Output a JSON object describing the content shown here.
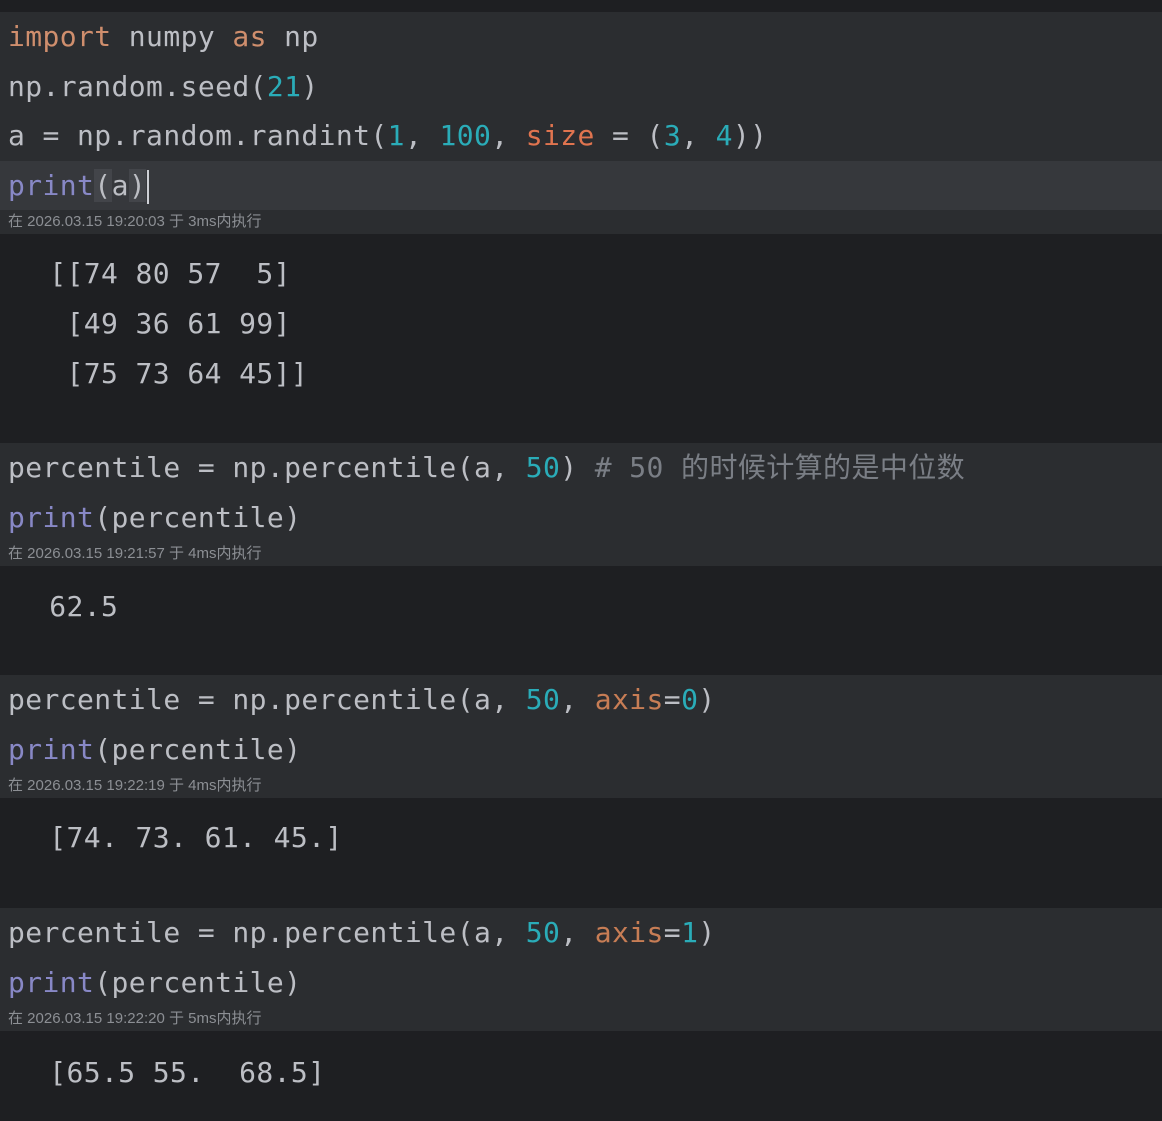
{
  "cells": [
    {
      "code_lines": [
        [
          {
            "t": "import",
            "c": "kw"
          },
          {
            "t": " numpy ",
            "c": "plain"
          },
          {
            "t": "as",
            "c": "kw"
          },
          {
            "t": " np",
            "c": "plain"
          }
        ],
        [
          {
            "t": "np.random.seed(",
            "c": "plain"
          },
          {
            "t": "21",
            "c": "num"
          },
          {
            "t": ")",
            "c": "plain"
          }
        ],
        [
          {
            "t": "a = np.random.randint(",
            "c": "plain"
          },
          {
            "t": "1",
            "c": "num"
          },
          {
            "t": ", ",
            "c": "plain"
          },
          {
            "t": "100",
            "c": "num"
          },
          {
            "t": ", ",
            "c": "plain"
          },
          {
            "t": "size",
            "c": "param"
          },
          {
            "t": " = (",
            "c": "plain"
          },
          {
            "t": "3",
            "c": "num"
          },
          {
            "t": ", ",
            "c": "plain"
          },
          {
            "t": "4",
            "c": "num"
          },
          {
            "t": "))",
            "c": "plain"
          }
        ],
        [
          {
            "t": "print",
            "c": "builtin"
          },
          {
            "t": "(",
            "c": "plain bracket-hl"
          },
          {
            "t": "a",
            "c": "plain"
          },
          {
            "t": ")",
            "c": "plain bracket-hl"
          }
        ]
      ],
      "current_line": 3,
      "exec_info": "在 2026.03.15 19:20:03 于 3ms内执行",
      "output": [
        " [[74 80 57  5]",
        "  [49 36 61 99]",
        "  [75 73 64 45]]"
      ]
    },
    {
      "code_lines": [
        [
          {
            "t": "percentile = np.percentile(a, ",
            "c": "plain"
          },
          {
            "t": "50",
            "c": "num"
          },
          {
            "t": ") ",
            "c": "plain"
          },
          {
            "t": "# 50 的时候计算的是中位数",
            "c": "comment"
          }
        ],
        [
          {
            "t": "print",
            "c": "builtin"
          },
          {
            "t": "(percentile)",
            "c": "plain"
          }
        ]
      ],
      "current_line": -1,
      "exec_info": "在 2026.03.15 19:21:57 于 4ms内执行",
      "output": [
        " 62.5"
      ]
    },
    {
      "code_lines": [
        [
          {
            "t": "percentile = np.percentile(a, ",
            "c": "plain"
          },
          {
            "t": "50",
            "c": "num"
          },
          {
            "t": ", ",
            "c": "plain"
          },
          {
            "t": "axis",
            "c": "param2"
          },
          {
            "t": "=",
            "c": "plain"
          },
          {
            "t": "0",
            "c": "num"
          },
          {
            "t": ")",
            "c": "plain"
          }
        ],
        [
          {
            "t": "print",
            "c": "builtin"
          },
          {
            "t": "(percentile)",
            "c": "plain"
          }
        ]
      ],
      "current_line": -1,
      "exec_info": "在 2026.03.15 19:22:19 于 4ms内执行",
      "output": [
        " [74. 73. 61. 45.]"
      ]
    },
    {
      "code_lines": [
        [
          {
            "t": "percentile = np.percentile(a, ",
            "c": "plain"
          },
          {
            "t": "50",
            "c": "num"
          },
          {
            "t": ", ",
            "c": "plain"
          },
          {
            "t": "axis",
            "c": "param2"
          },
          {
            "t": "=",
            "c": "plain"
          },
          {
            "t": "1",
            "c": "num"
          },
          {
            "t": ")",
            "c": "plain"
          }
        ],
        [
          {
            "t": "print",
            "c": "builtin"
          },
          {
            "t": "(percentile)",
            "c": "plain"
          }
        ]
      ],
      "current_line": -1,
      "exec_info": "在 2026.03.15 19:22:20 于 5ms内执行",
      "output": [
        " [65.5 55.  68.5]"
      ]
    }
  ]
}
